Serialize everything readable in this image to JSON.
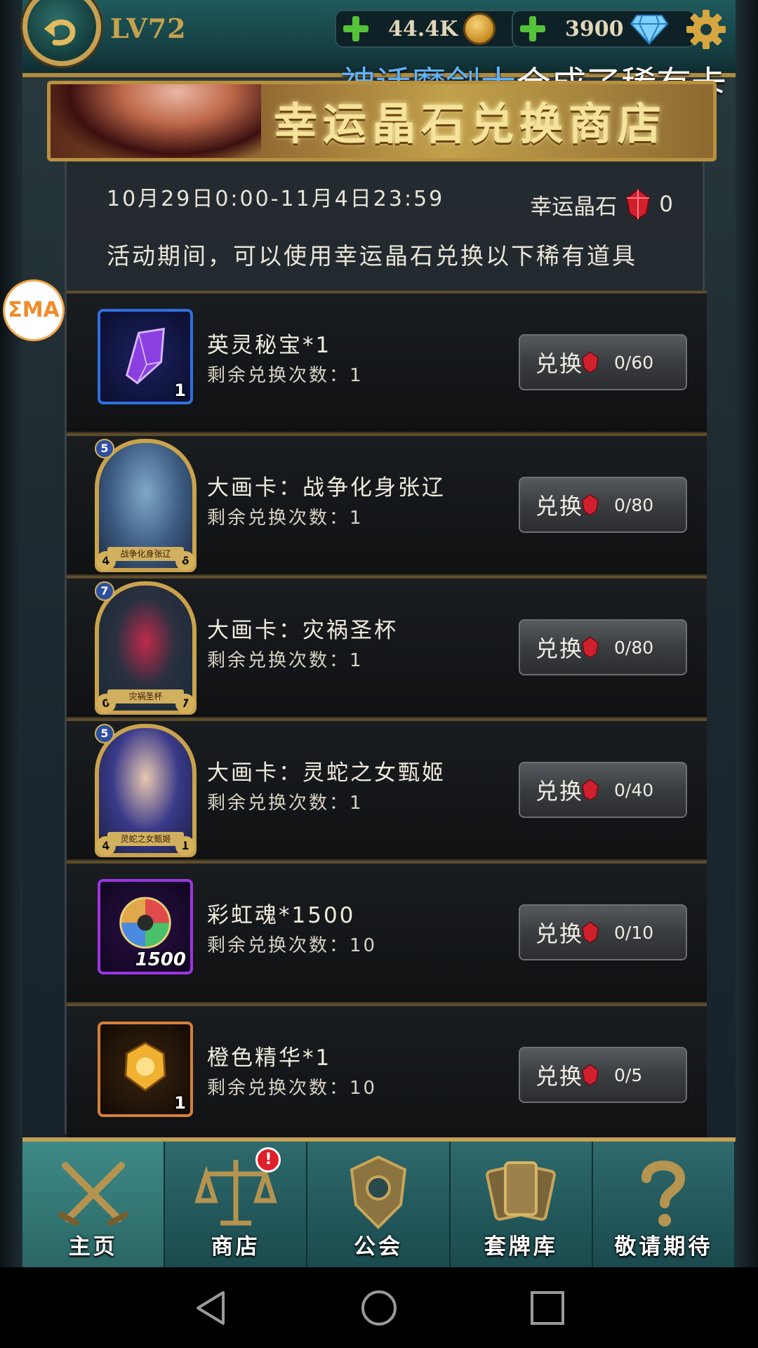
{
  "topbar": {
    "level": "LV72",
    "gold": "44.4K",
    "diamonds": "3900",
    "marquee_name": "神话魔剑士",
    "marquee_text": "合成了稀有卡"
  },
  "banner": {
    "title": "幸运晶石兑换商店"
  },
  "event": {
    "period": "10月29日0:00-11月4日23:59",
    "lucky_label": "幸运晶石",
    "lucky_count": "0",
    "description": "活动期间，可以使用幸运晶石兑换以下稀有道具"
  },
  "items": [
    {
      "name": "英灵秘宝*1",
      "remain": "剩余兑换次数：1",
      "button": "兑换",
      "cost": "0/60",
      "qty": "1"
    },
    {
      "name": "大画卡：战争化身张辽",
      "remain": "剩余兑换次数：1",
      "button": "兑换",
      "cost": "0/80",
      "card_name": "战争化身张辽",
      "badge_top": "5",
      "badge_left": "4",
      "badge_right": "6"
    },
    {
      "name": "大画卡：灾祸圣杯",
      "remain": "剩余兑换次数：1",
      "button": "兑换",
      "cost": "0/80",
      "card_name": "灾祸圣杯",
      "badge_top": "7",
      "badge_left": "0",
      "badge_right": "7"
    },
    {
      "name": "大画卡：灵蛇之女甄姬",
      "remain": "剩余兑换次数：1",
      "button": "兑换",
      "cost": "0/40",
      "card_name": "灵蛇之女甄姬",
      "badge_top": "5",
      "badge_left": "4",
      "badge_right": "1"
    },
    {
      "name": "彩虹魂*1500",
      "remain": "剩余兑换次数：10",
      "button": "兑换",
      "cost": "0/10",
      "qty": "1500"
    },
    {
      "name": "橙色精华*1",
      "remain": "剩余兑换次数：10",
      "button": "兑换",
      "cost": "0/5",
      "qty": "1"
    }
  ],
  "nav": [
    {
      "label": "主页",
      "icon": "crossed-swords-icon"
    },
    {
      "label": "商店",
      "icon": "scales-icon",
      "alert": "!"
    },
    {
      "label": "公会",
      "icon": "guild-emblem-icon"
    },
    {
      "label": "套牌库",
      "icon": "cards-icon"
    },
    {
      "label": "敬请期待",
      "icon": "question-mark-icon"
    }
  ],
  "overlay": {
    "ema": "ΣMA"
  },
  "colors": {
    "accent_gold": "#c6a053",
    "teal": "#1f5a5c",
    "ruby": "#d0202e"
  }
}
